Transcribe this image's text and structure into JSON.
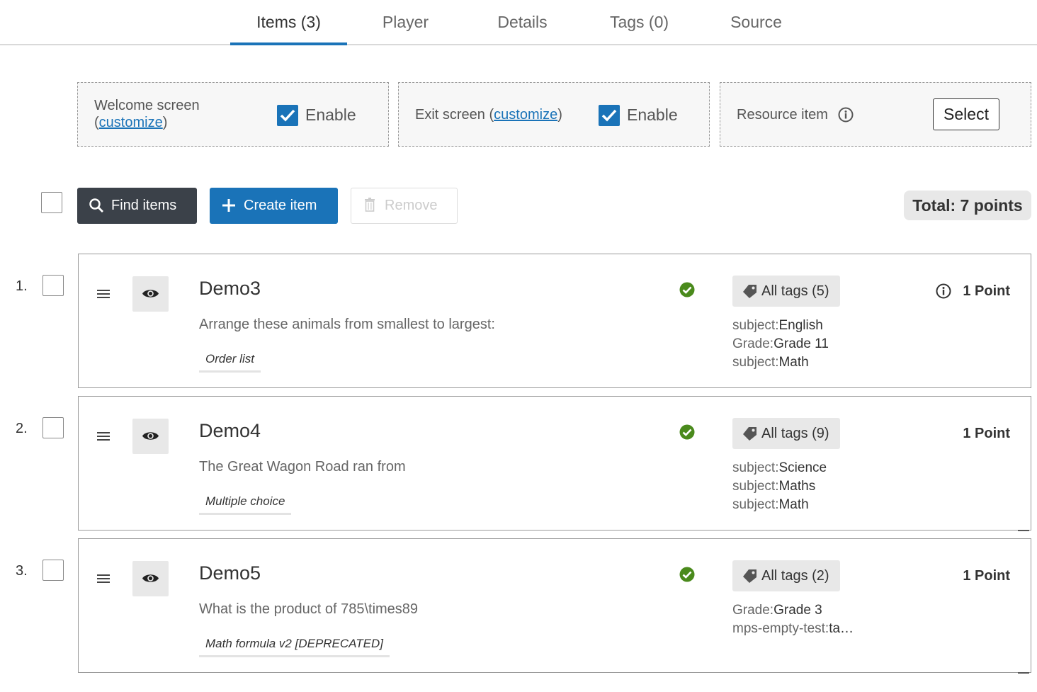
{
  "tabs": [
    {
      "label": "Items (3)",
      "active": true
    },
    {
      "label": "Player",
      "active": false
    },
    {
      "label": "Details",
      "active": false
    },
    {
      "label": "Tags (0)",
      "active": false
    },
    {
      "label": "Source",
      "active": false
    }
  ],
  "settings": {
    "welcome": {
      "label": "Welcome screen",
      "open_paren": "(",
      "link": "customize",
      "close_paren": ")",
      "enable_label": "Enable",
      "enabled": true
    },
    "exit": {
      "label": "Exit screen (",
      "link": "customize",
      "close_paren": ")",
      "enable_label": "Enable",
      "enabled": true
    },
    "resource": {
      "label": "Resource item",
      "icon": "info-icon",
      "select_label": "Select"
    }
  },
  "toolbar": {
    "find_label": "Find items",
    "create_label": "Create item",
    "remove_label": "Remove",
    "total_label": "Total: 7 points"
  },
  "colors": {
    "accent": "#1a73b8",
    "dark_button": "#3b4149",
    "status_ok": "#4a8a1c"
  },
  "items": [
    {
      "number": "1.",
      "title": "Demo3",
      "text": "Arrange these animals from smallest to largest:",
      "type": "Order list",
      "tags_label": "All tags (5)",
      "tags": [
        {
          "key": "subject:",
          "value": "English"
        },
        {
          "key": "Grade:",
          "value": "Grade 11"
        },
        {
          "key": "subject:",
          "value": "Math"
        }
      ],
      "points": "1 Point",
      "show_points_info": true
    },
    {
      "number": "2.",
      "title": "Demo4",
      "text": "The Great Wagon Road ran from",
      "type": "Multiple choice",
      "tags_label": "All tags (9)",
      "tags": [
        {
          "key": "subject:",
          "value": "Science"
        },
        {
          "key": "subject:",
          "value": "Maths"
        },
        {
          "key": "subject:",
          "value": "Math"
        }
      ],
      "points": "1 Point",
      "show_points_info": false
    },
    {
      "number": "3.",
      "title": "Demo5",
      "text": "What is the product of 785\\times89",
      "type": "Math formula v2 [DEPRECATED]",
      "tags_label": "All tags (2)",
      "tags": [
        {
          "key": "Grade:",
          "value": "Grade 3"
        },
        {
          "key": "mps-empty-test:",
          "value": "ta…"
        }
      ],
      "points": "1 Point",
      "show_points_info": false
    }
  ]
}
